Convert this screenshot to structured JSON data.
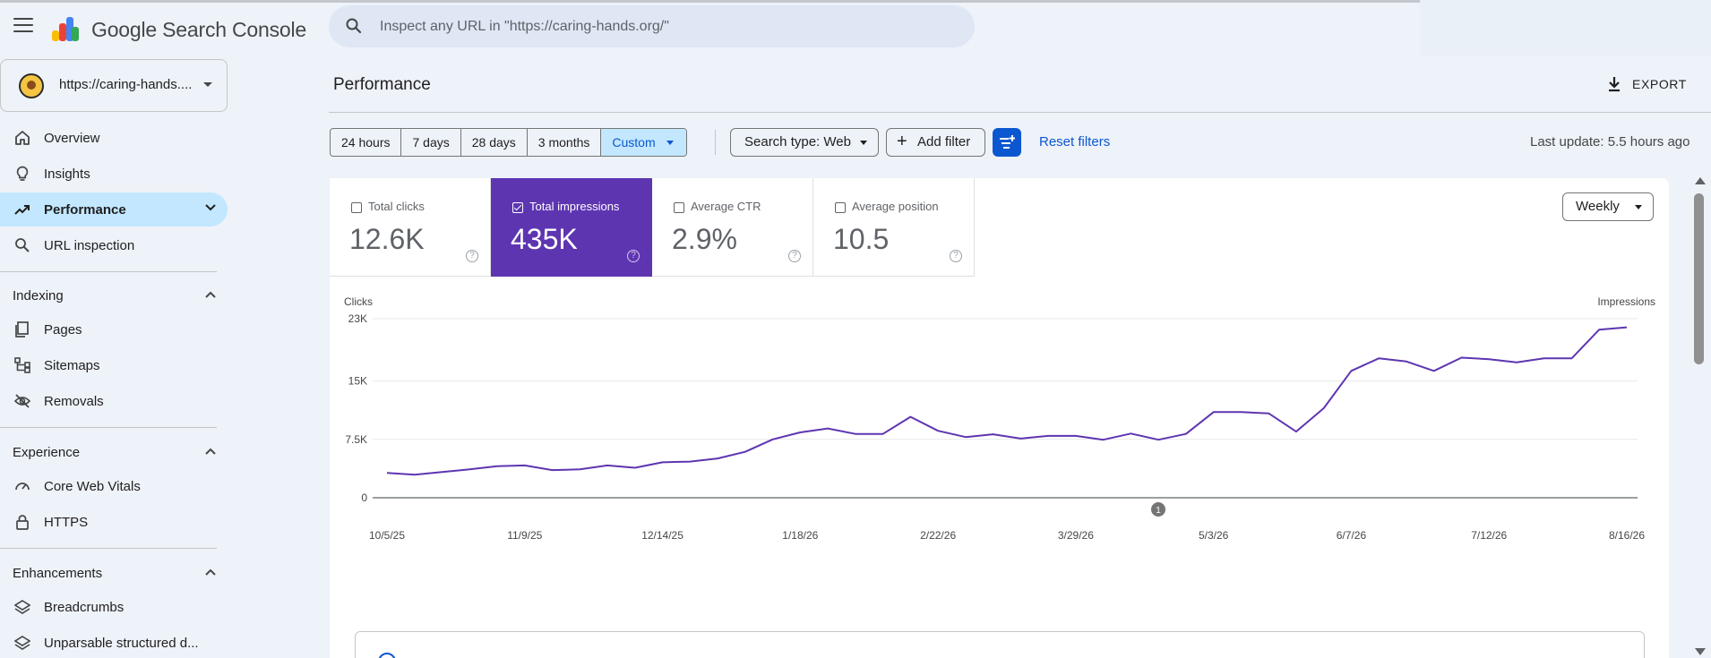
{
  "header": {
    "app_title": "Google Search Console",
    "search_placeholder": "Inspect any URL in \"https://caring-hands.org/\""
  },
  "sidebar": {
    "property": "https://caring-hands....",
    "items_top": [
      {
        "label": "Overview",
        "icon": "home-icon"
      },
      {
        "label": "Insights",
        "icon": "lightbulb-icon"
      },
      {
        "label": "Performance",
        "icon": "trending-up-icon",
        "active": true
      },
      {
        "label": "URL inspection",
        "icon": "search-icon"
      }
    ],
    "sections": [
      {
        "title": "Indexing",
        "items": [
          {
            "label": "Pages",
            "icon": "pages-icon"
          },
          {
            "label": "Sitemaps",
            "icon": "sitemap-icon"
          },
          {
            "label": "Removals",
            "icon": "eye-off-icon"
          }
        ]
      },
      {
        "title": "Experience",
        "items": [
          {
            "label": "Core Web Vitals",
            "icon": "gauge-icon"
          },
          {
            "label": "HTTPS",
            "icon": "lock-icon"
          }
        ]
      },
      {
        "title": "Enhancements",
        "items": [
          {
            "label": "Breadcrumbs",
            "icon": "layers-icon"
          },
          {
            "label": "Unparsable structured d...",
            "icon": "layers-icon"
          }
        ]
      }
    ]
  },
  "main": {
    "page_title": "Performance",
    "export_label": "EXPORT",
    "date_ranges": [
      "24 hours",
      "7 days",
      "28 days",
      "3 months",
      "Custom"
    ],
    "selected_range": "Custom",
    "search_type": "Search type: Web",
    "add_filter": "Add filter",
    "reset_filters": "Reset filters",
    "last_update": "Last update: 5.5 hours ago",
    "interval": "Weekly",
    "metrics": [
      {
        "name": "Total clicks",
        "value": "12.6K",
        "selected": false
      },
      {
        "name": "Total impressions",
        "value": "435K",
        "selected": true
      },
      {
        "name": "Average CTR",
        "value": "2.9%",
        "selected": false
      },
      {
        "name": "Average position",
        "value": "10.5",
        "selected": false
      }
    ],
    "annotation_marker": "1"
  },
  "colors": {
    "accent": "#5e35b1",
    "link": "#0b57d0",
    "active_nav": "#c2e7ff"
  },
  "chart_data": {
    "type": "line",
    "left_axis_title": "Clicks",
    "right_axis_title": "Impressions",
    "yticks": [
      "0",
      "7.5K",
      "15K",
      "23K"
    ],
    "ylim": [
      0,
      23000
    ],
    "xticks": [
      "10/5/25",
      "11/9/25",
      "12/14/25",
      "1/18/26",
      "2/22/26",
      "3/29/26",
      "5/3/26",
      "6/7/26",
      "7/12/26",
      "8/16/26"
    ],
    "series": [
      {
        "name": "Total impressions",
        "color": "#5e35b1",
        "values": [
          3200,
          2950,
          3300,
          3650,
          4050,
          4150,
          3550,
          3650,
          4150,
          3850,
          4550,
          4650,
          5050,
          5900,
          7500,
          8400,
          8900,
          8200,
          8200,
          10400,
          8600,
          7800,
          8150,
          7600,
          7950,
          7950,
          7450,
          8250,
          7450,
          8200,
          11000,
          11000,
          10850,
          8500,
          11500,
          16300,
          17900,
          17500,
          16300,
          18000,
          17800,
          17400,
          17900,
          17900,
          21600,
          21900
        ]
      }
    ]
  }
}
